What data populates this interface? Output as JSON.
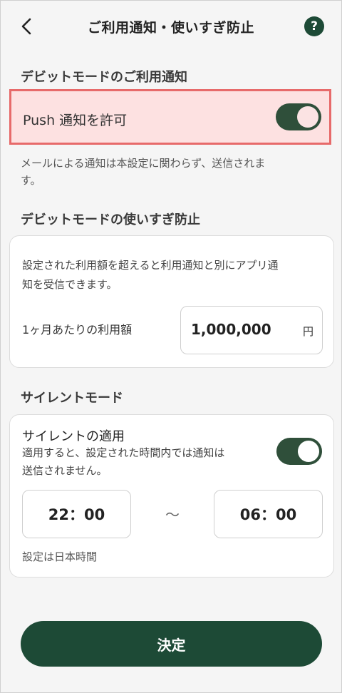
{
  "header": {
    "title": "ご利用通知・使いすぎ防止",
    "help_label": "?"
  },
  "debit_notice": {
    "section_title": "デビットモードのご利用通知",
    "push_label": "Push 通知を許可",
    "push_enabled": true,
    "email_note_line1": "メールによる通知は本設定に関わらず、送信されま",
    "email_note_line2": "す。"
  },
  "overuse": {
    "section_title": "デビットモードの使いすぎ防止",
    "desc_line1": "設定された利用額を超えると利用通知と別にアプリ通",
    "desc_line2": "知を受信できます。",
    "monthly_label": "1ヶ月あたりの利用額",
    "amount_value": "1,000,000",
    "amount_unit": "円"
  },
  "silent": {
    "section_title": "サイレントモード",
    "apply_label": "サイレントの適用",
    "desc_line1": "適用すると、設定された時間内では通知は",
    "desc_line2": "送信されません。",
    "enabled": true,
    "start_time": "22：00",
    "separator": "～",
    "end_time": "06：00",
    "timezone_note": "設定は日本時間"
  },
  "submit_label": "決定",
  "colors": {
    "brand": "#1d4a36",
    "toggle_on": "#2f4f3a",
    "highlight_bg": "#fde1e1",
    "highlight_border": "#e76a6a"
  }
}
